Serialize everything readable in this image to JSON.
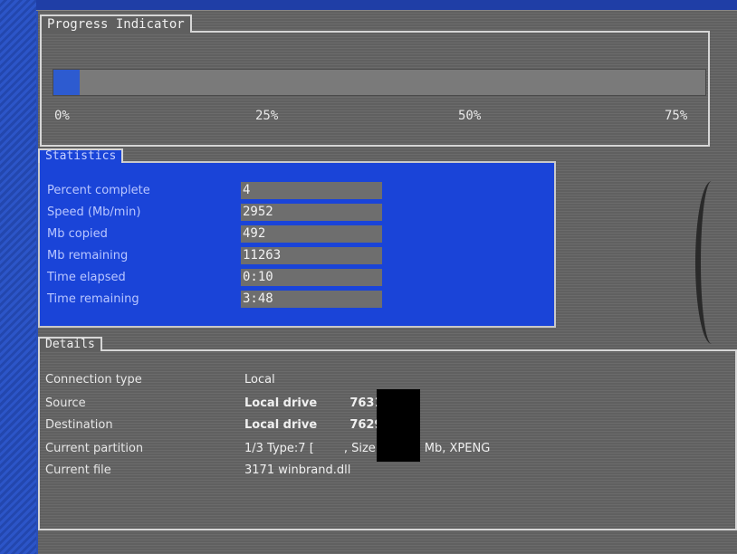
{
  "progress": {
    "legend": "Progress Indicator",
    "percent": 4,
    "ticks": [
      "0%",
      "25%",
      "50%",
      "75%"
    ]
  },
  "statistics": {
    "legend": "Statistics",
    "rows": [
      {
        "label": "Percent complete",
        "value": "4"
      },
      {
        "label": "Speed (Mb/min)",
        "value": "2952"
      },
      {
        "label": "Mb copied",
        "value": "492"
      },
      {
        "label": "Mb remaining",
        "value": "11263"
      },
      {
        "label": "Time elapsed",
        "value": "0:10"
      },
      {
        "label": "Time remaining",
        "value": "3:48"
      }
    ]
  },
  "details": {
    "legend": "Details",
    "rows": [
      {
        "label": "Connection type",
        "value": "Local"
      },
      {
        "label": "Source",
        "value": "Local drive        76319 Mb"
      },
      {
        "label": "Destination",
        "value": "Local drive        76293 Mb"
      },
      {
        "label": "Current partition",
        "value": "1/3 Type:7 [        , Size: 60000 Mb, XPENG"
      },
      {
        "label": "Current file",
        "value": "3171 winbrand.dll"
      }
    ]
  },
  "colors": {
    "accent": "#1a44d8",
    "panel": "#606060",
    "bar": "#2d5bd0"
  }
}
